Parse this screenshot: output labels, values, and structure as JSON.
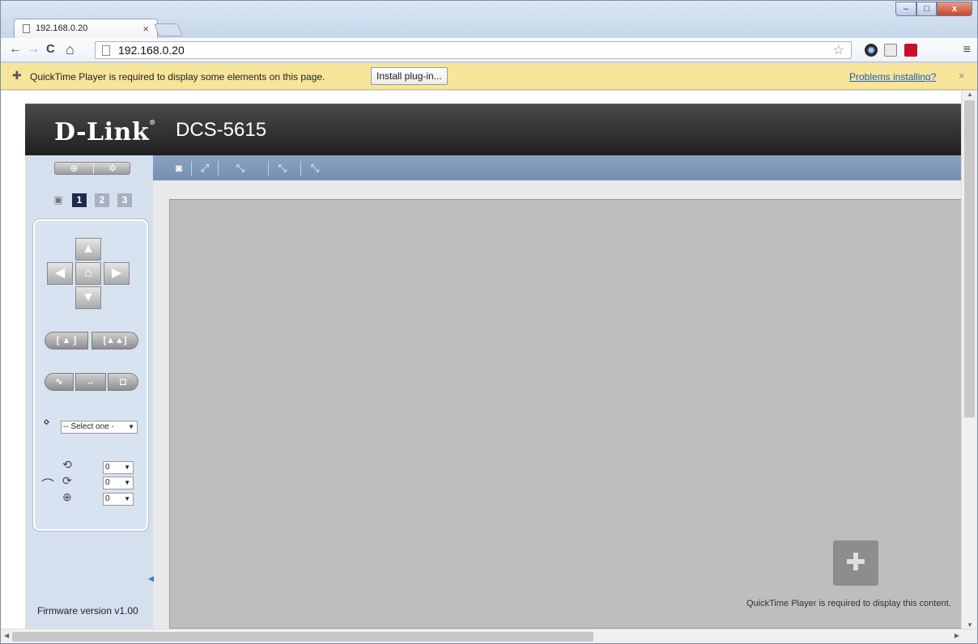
{
  "browser": {
    "tab_title": "192.168.0.20",
    "tab_close": "×",
    "url": "192.168.0.20",
    "window_buttons": {
      "minimize": "–",
      "maximize": "□",
      "close": "x"
    },
    "nav": {
      "back": "←",
      "forward": "→",
      "reload": "C",
      "home": "⌂",
      "star": "☆",
      "menu": "≡"
    }
  },
  "infobar": {
    "message": "QuickTime Player is required to display some elements on this page.",
    "install_button": "Install plug-in...",
    "problems_link": "Problems installing?",
    "close": "×"
  },
  "camera_page": {
    "brand": "D-Link",
    "model": "DCS-5615",
    "camera_tabs": [
      "1",
      "2",
      "3"
    ],
    "top_tools": [
      "snapshot-icon",
      "fullscreen-icon",
      "zoom-100-icon",
      "zoom-50-icon",
      "zoom-25-icon"
    ],
    "ptz": {
      "preset_select": "-- Select one -",
      "pan_speed": "0",
      "tilt_speed": "0",
      "zoom_speed": "0"
    },
    "firmware": "Firmware version v1.00",
    "plugin_message": "QuickTime Player is required to display this content."
  }
}
